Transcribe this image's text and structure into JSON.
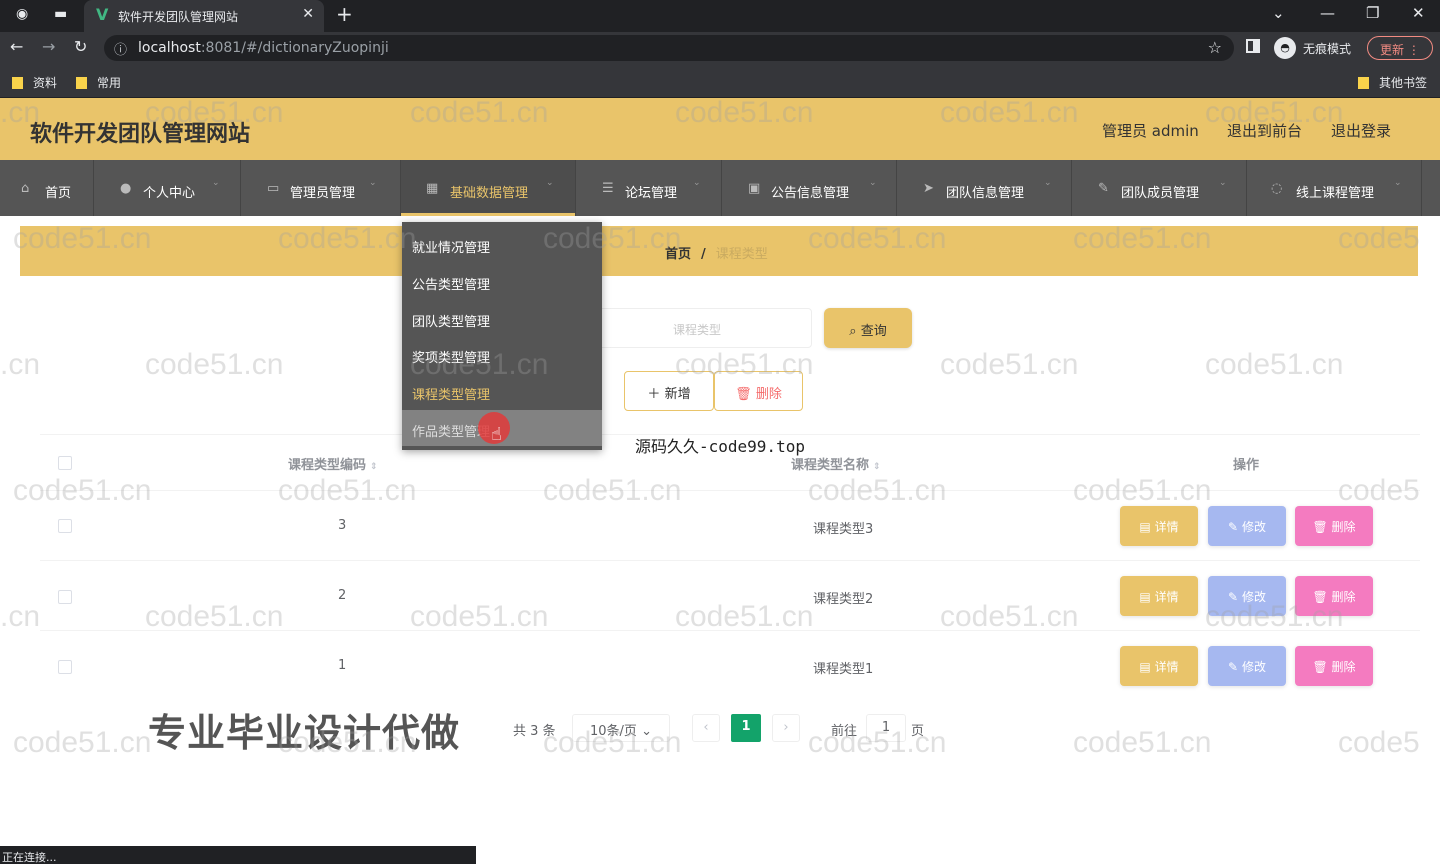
{
  "browser": {
    "tab_title": "软件开发团队管理网站",
    "url_host": "localhost",
    "url_path": ":8081/#/dictionaryZuopinji",
    "incognito_label": "无痕模式",
    "update_label": "更新",
    "bookmarks": [
      "资料",
      "常用"
    ],
    "other_bookmarks": "其他书签",
    "status_text": "正在连接..."
  },
  "header": {
    "title": "软件开发团队管理网站",
    "admin_label": "管理员 admin",
    "back_front": "退出到前台",
    "logout": "退出登录"
  },
  "nav": [
    {
      "label": "首页",
      "icon": "home-icon"
    },
    {
      "label": "个人中心",
      "icon": "user-icon"
    },
    {
      "label": "管理员管理",
      "icon": "monitor-icon"
    },
    {
      "label": "基础数据管理",
      "icon": "grid-icon"
    },
    {
      "label": "论坛管理",
      "icon": "list-icon"
    },
    {
      "label": "公告信息管理",
      "icon": "camera-icon"
    },
    {
      "label": "团队信息管理",
      "icon": "send-icon"
    },
    {
      "label": "团队成员管理",
      "icon": "edit-icon"
    },
    {
      "label": "线上课程管理",
      "icon": "clock-icon"
    }
  ],
  "dropdown": [
    "就业情况管理",
    "公告类型管理",
    "团队类型管理",
    "奖项类型管理",
    "课程类型管理",
    "作品类型管理"
  ],
  "breadcrumb": {
    "home": "首页",
    "separator": "/",
    "current": "课程类型"
  },
  "search": {
    "placeholder": "课程类型",
    "button": "查询"
  },
  "actions": {
    "add": "新增",
    "delete": "删除"
  },
  "overlay_text": "源码久久-code99.top",
  "table": {
    "headers": [
      "课程类型编码",
      "课程类型名称",
      "操作"
    ],
    "rows": [
      {
        "code": "3",
        "name": "课程类型3"
      },
      {
        "code": "2",
        "name": "课程类型2"
      },
      {
        "code": "1",
        "name": "课程类型1"
      }
    ],
    "op_detail": "详情",
    "op_edit": "修改",
    "op_delete": "删除"
  },
  "pagination": {
    "total": "共 3 条",
    "page_size": "10条/页",
    "current": "1",
    "goto_prefix": "前往",
    "goto_value": "1",
    "goto_suffix": "页"
  },
  "banner_text": "专业毕业设计代做",
  "watermark": "code51.cn"
}
